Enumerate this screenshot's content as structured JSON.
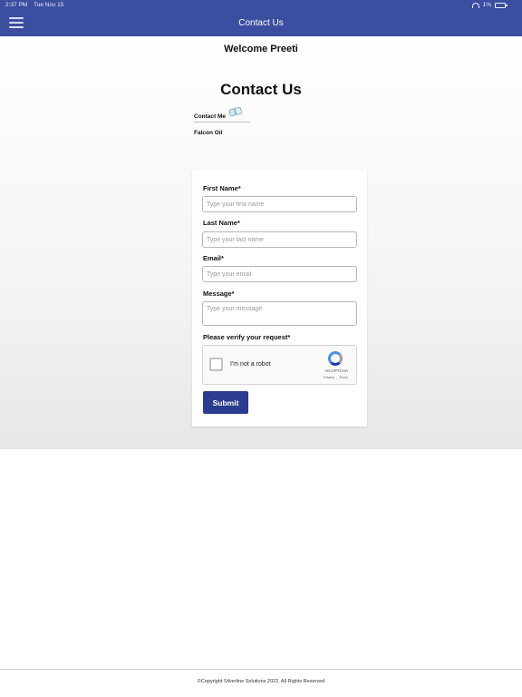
{
  "status_bar": {
    "time": "2:37 PM",
    "date": "Tue Nov 15",
    "battery": "1%"
  },
  "nav": {
    "title": "Contact Us",
    "menu_icon": "hamburger-menu-icon"
  },
  "main": {
    "welcome": "Welcome Preeti",
    "heading": "Contact Us",
    "contact_nav": {
      "contact_me": "Contact Me",
      "contact_me_icon": "open-book-icon",
      "company": "Falcon Oil"
    }
  },
  "form": {
    "first_name": {
      "label": "First Name*",
      "placeholder": "Type your first name"
    },
    "last_name": {
      "label": "Last Name*",
      "placeholder": "Type your last name"
    },
    "email": {
      "label": "Email*",
      "placeholder": "Type your email"
    },
    "message": {
      "label": "Message*",
      "placeholder": "Type your message"
    },
    "verify_label": "Please verify your request*",
    "captcha": {
      "checkbox_text": "I'm not a robot",
      "brand": "reCAPTCHA",
      "privacy": "Privacy",
      "separator": "-",
      "terms": "Terms"
    },
    "submit_label": "Submit"
  },
  "colors": {
    "header": "#3c4ea0",
    "submit": "#2c3c8f"
  },
  "footer": {
    "copyright": "©Copyright Silverline Solutions 2022. All Rights Reserved"
  }
}
